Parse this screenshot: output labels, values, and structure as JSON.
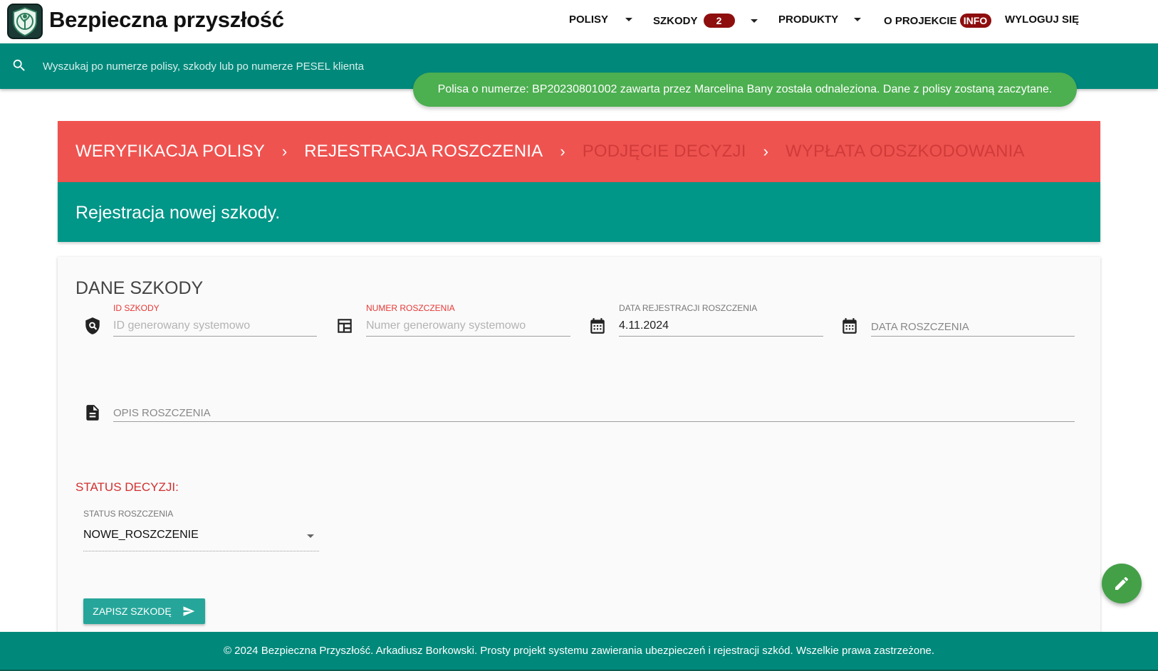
{
  "header": {
    "brand": "Bezpieczna przyszłość",
    "nav": {
      "polisy": "POLISY",
      "szkody": "SZKODY",
      "szkody_badge": "2",
      "produkty": "PRODUKTY",
      "o_projekcie": "O PROJEKCIE",
      "o_projekcie_badge": "INFO",
      "wyloguj": "WYLOGUJ SIĘ"
    }
  },
  "search": {
    "placeholder": "Wyszukaj po numerze polisy, szkody lub po numerze PESEL klienta"
  },
  "toast": {
    "message": "Polisa o numerze: BP20230801002 zawarta przez Marcelina Bany została odnaleziona. Dane z polisy zostaną zaczytane."
  },
  "stepper": {
    "steps": [
      "WERYFIKACJA POLISY",
      "REJESTRACJA ROSZCZENIA",
      "PODJĘCIE DECYZJI",
      "WYPŁATA ODSZKODOWANIA"
    ],
    "active_count": 2
  },
  "subheader": {
    "title": "Rejestracja nowej szkody."
  },
  "card": {
    "title": "DANE SZKODY",
    "fields": {
      "id_szkody": {
        "label": "ID SZKODY",
        "placeholder": "ID generowany systemowo"
      },
      "numer_roszczenia": {
        "label": "NUMER ROSZCZENIA",
        "placeholder": "Numer generowany systemowo"
      },
      "data_rejestracji": {
        "label": "DATA REJESTRACJI ROSZCZENIA",
        "value": "4.11.2024"
      },
      "data_roszczenia": {
        "label": "DATA ROSZCZENIA"
      },
      "opis": {
        "label": "OPIS ROSZCZENIA"
      }
    },
    "status_title": "STATUS DECYZJI:",
    "status_select": {
      "label": "STATUS ROSZCZENIA",
      "value": "NOWE_ROSZCZENIE"
    },
    "save_button": "ZAPISZ SZKODĘ"
  },
  "footer": {
    "text": "© 2024 Bezpieczna Przyszłość. Arkadiusz Borkowski. Prosty projekt systemu zawierania ubezpieczeń i rejestracji szkód. Wszelkie prawa zastrzeżone."
  },
  "colors": {
    "teal": "#00897b",
    "stepper_red": "#ef5350",
    "toast_green": "#4caf50",
    "badge_red": "#8e0e0e"
  }
}
